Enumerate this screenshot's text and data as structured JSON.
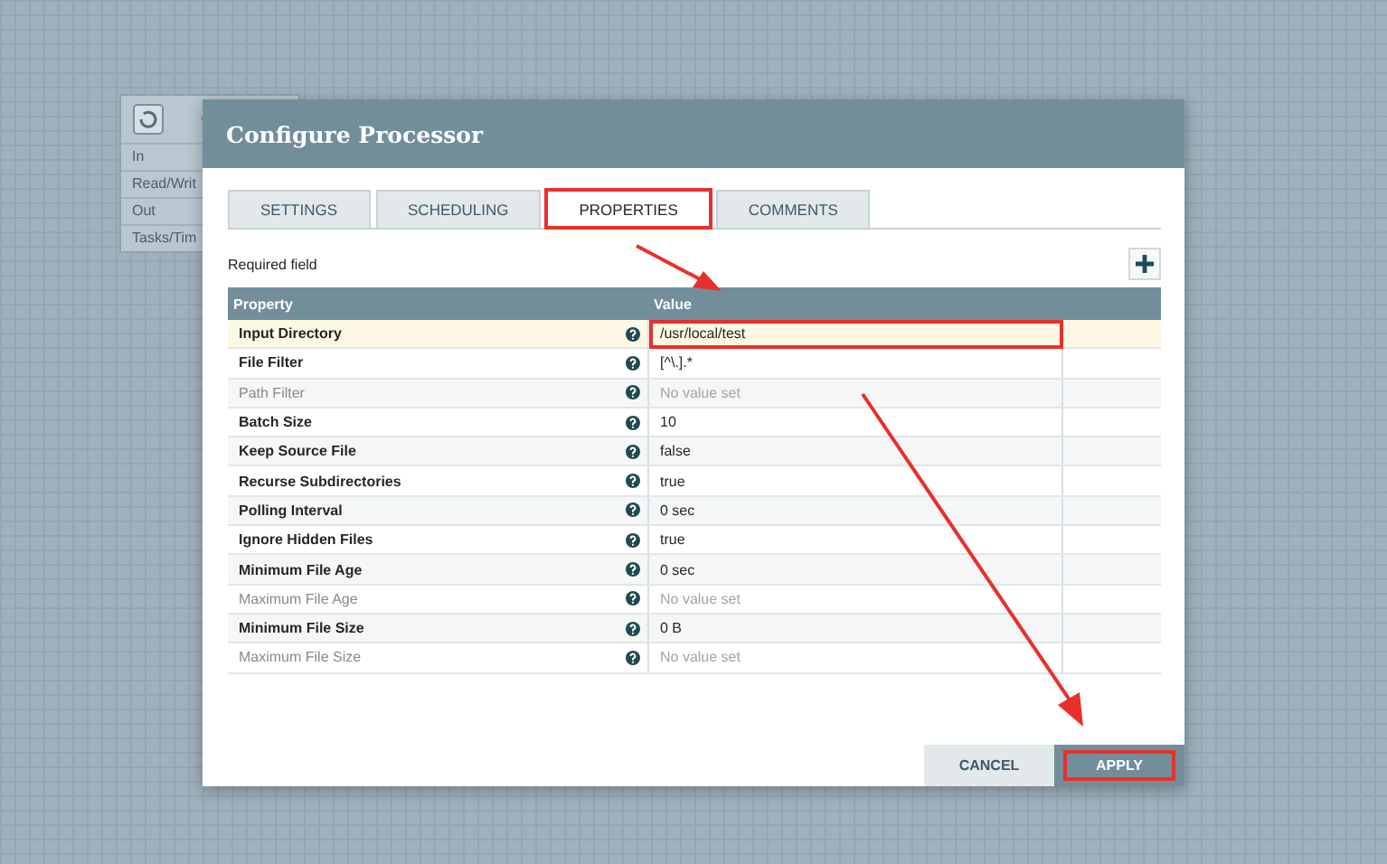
{
  "processor_card": {
    "stats": [
      "In",
      "Read/Writ",
      "Out",
      "Tasks/Tim"
    ]
  },
  "dialog": {
    "title": "Configure Processor",
    "tabs": [
      {
        "label": "SETTINGS",
        "selected": false,
        "highlighted": false
      },
      {
        "label": "SCHEDULING",
        "selected": false,
        "highlighted": false
      },
      {
        "label": "PROPERTIES",
        "selected": true,
        "highlighted": true
      },
      {
        "label": "COMMENTS",
        "selected": false,
        "highlighted": false
      }
    ],
    "required_note": "Required field",
    "table": {
      "columns": [
        "Property",
        "Value"
      ],
      "rows": [
        {
          "property": "Input Directory",
          "required": true,
          "value": "/usr/local/test",
          "value_set": true,
          "selected": true,
          "highlighted": true
        },
        {
          "property": "File Filter",
          "required": true,
          "value": "[^\\.].*",
          "value_set": true,
          "selected": false,
          "highlighted": false
        },
        {
          "property": "Path Filter",
          "required": false,
          "value": "No value set",
          "value_set": false,
          "selected": false,
          "highlighted": false
        },
        {
          "property": "Batch Size",
          "required": true,
          "value": "10",
          "value_set": true,
          "selected": false,
          "highlighted": false
        },
        {
          "property": "Keep Source File",
          "required": true,
          "value": "false",
          "value_set": true,
          "selected": false,
          "highlighted": false
        },
        {
          "property": "Recurse Subdirectories",
          "required": true,
          "value": "true",
          "value_set": true,
          "selected": false,
          "highlighted": false
        },
        {
          "property": "Polling Interval",
          "required": true,
          "value": "0 sec",
          "value_set": true,
          "selected": false,
          "highlighted": false
        },
        {
          "property": "Ignore Hidden Files",
          "required": true,
          "value": "true",
          "value_set": true,
          "selected": false,
          "highlighted": false
        },
        {
          "property": "Minimum File Age",
          "required": true,
          "value": "0 sec",
          "value_set": true,
          "selected": false,
          "highlighted": false
        },
        {
          "property": "Maximum File Age",
          "required": false,
          "value": "No value set",
          "value_set": false,
          "selected": false,
          "highlighted": false
        },
        {
          "property": "Minimum File Size",
          "required": true,
          "value": "0 B",
          "value_set": true,
          "selected": false,
          "highlighted": false
        },
        {
          "property": "Maximum File Size",
          "required": false,
          "value": "No value set",
          "value_set": false,
          "selected": false,
          "highlighted": false
        }
      ]
    },
    "buttons": [
      {
        "label": "CANCEL",
        "kind": "secondary",
        "highlighted": false
      },
      {
        "label": "APPLY",
        "kind": "primary",
        "highlighted": true
      }
    ]
  }
}
